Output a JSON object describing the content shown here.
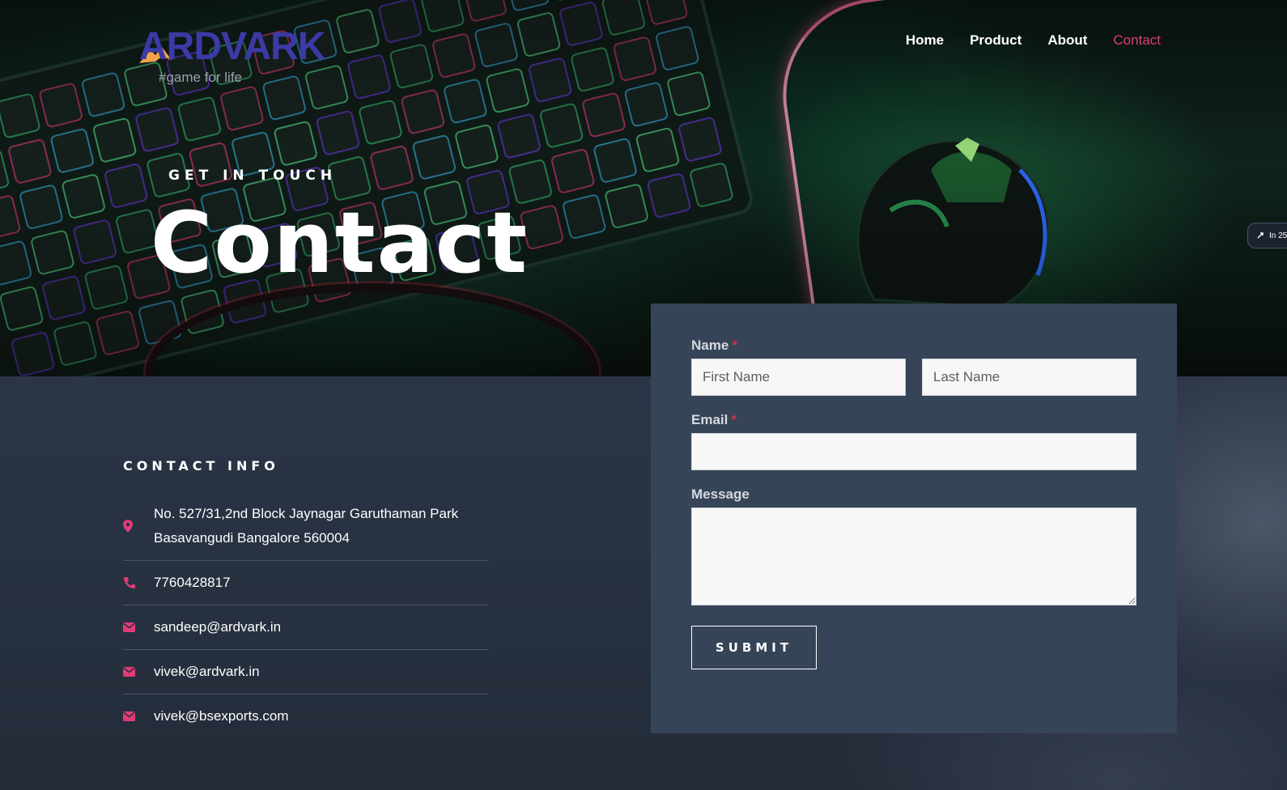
{
  "brand": {
    "logo_text": "ARDVARK",
    "tagline": "#game for life"
  },
  "nav": {
    "items": [
      {
        "label": "Home"
      },
      {
        "label": "Product"
      },
      {
        "label": "About"
      },
      {
        "label": "Contact"
      }
    ],
    "active": "Contact"
  },
  "hero": {
    "kicker": "GET IN TOUCH",
    "title": "Contact"
  },
  "side_widget": {
    "label": "In 25"
  },
  "contact_info": {
    "title": "CONTACT INFO",
    "address_line1": "No. 527/31,2nd Block Jaynagar Garuthaman Park",
    "address_line2": "Basavangudi Bangalore 560004",
    "phone": "7760428817",
    "emails": [
      "sandeep@ardvark.in",
      "vivek@ardvark.in",
      "vivek@bsexports.com"
    ]
  },
  "form": {
    "name_label": "Name",
    "required_mark": "*",
    "first_name_placeholder": "First Name",
    "last_name_placeholder": "Last Name",
    "email_label": "Email",
    "email_value": "",
    "message_label": "Message",
    "message_value": "",
    "submit_label": "SUBMIT"
  },
  "colors": {
    "accent": "#e23b78",
    "logo": "#3c3aa6",
    "card": "#364458",
    "lower_bg": "#27303f",
    "required": "#c8324f"
  },
  "icons": {
    "address": "map-pin-icon",
    "phone": "phone-icon",
    "email": "envelope-icon"
  }
}
